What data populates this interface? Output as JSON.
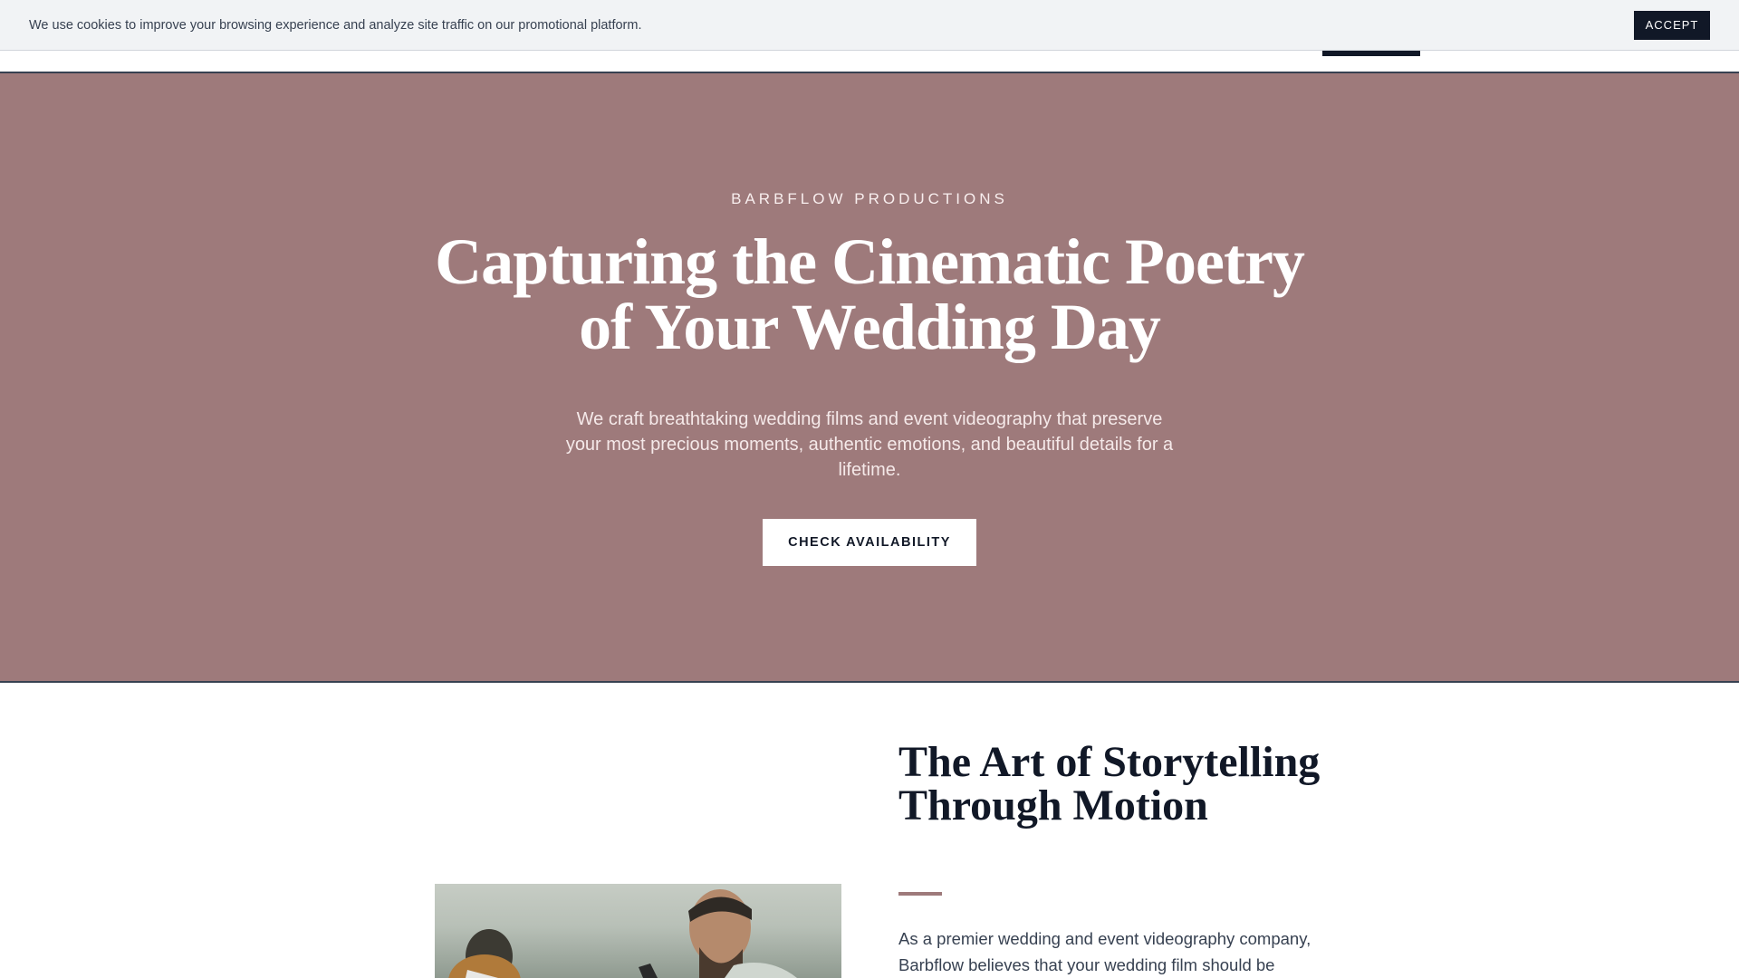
{
  "cookie_banner": {
    "message": "We use cookies to improve your browsing experience and analyze site traffic on our promotional platform.",
    "accept_label": "ACCEPT"
  },
  "hero": {
    "eyebrow": "BARBFLOW PRODUCTIONS",
    "title": "Capturing the Cinematic Poetry of Your Wedding Day",
    "subtitle": "We craft breathtaking wedding films and event videography that preserve your most precious moments, authentic emotions, and beautiful details for a lifetime.",
    "cta_label": "CHECK AVAILABILITY",
    "background_color": "#9e7a7b"
  },
  "about": {
    "title": "The Art of Storytelling Through Motion",
    "body": "As a premier wedding and event videography company, Barbflow believes that your wedding film should be",
    "accent_color": "#9e7a7b"
  }
}
